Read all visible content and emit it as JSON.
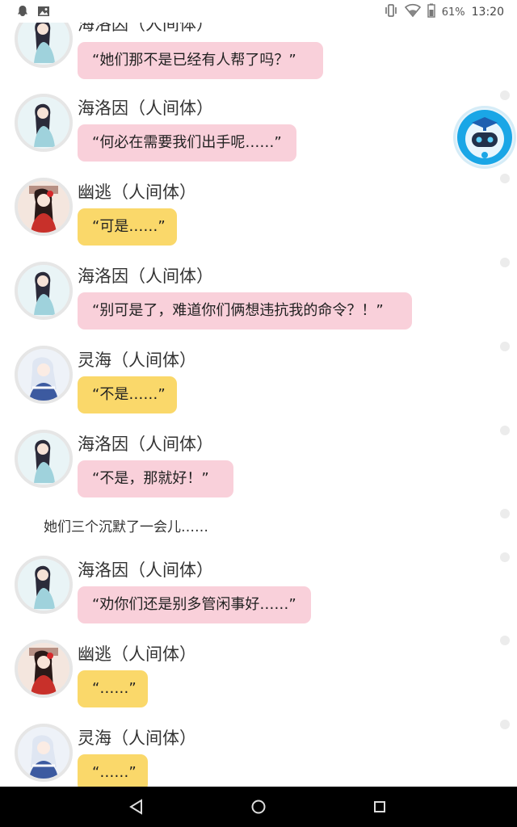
{
  "status_bar": {
    "battery": "61%",
    "time": "13:20"
  },
  "messages": [
    {
      "name": "海洛因（人间体）",
      "text": "“她们那不是已经有人帮了吗？”",
      "color": "pink",
      "avatar": "haeluoyin-avatar"
    },
    {
      "name": "海洛因（人间体）",
      "text": "“何必在需要我们出手呢……”",
      "color": "pink",
      "avatar": "haeluoyin-avatar"
    },
    {
      "name": "幽逃（人间体）",
      "text": "“可是……”",
      "color": "yellow",
      "avatar": "youtao-avatar"
    },
    {
      "name": "海洛因（人间体）",
      "text": "“别可是了，难道你们俩想违抗我的命令？！”",
      "color": "pink",
      "avatar": "haeluoyin-avatar"
    },
    {
      "name": "灵海（人间体）",
      "text": "“不是……”",
      "color": "yellow",
      "avatar": "linghai-avatar"
    },
    {
      "name": "海洛因（人间体）",
      "text": "“不是，那就好！”",
      "color": "pink",
      "avatar": "haeluoyin-avatar"
    },
    {
      "name": "海洛因（人间体）",
      "text": "“劝你们还是别多管闲事好……”",
      "color": "pink",
      "avatar": "haeluoyin-avatar"
    },
    {
      "name": "幽逃（人间体）",
      "text": "“……”",
      "color": "yellow",
      "avatar": "youtao-avatar"
    },
    {
      "name": "灵海（人间体）",
      "text": "“……”",
      "color": "yellow",
      "avatar": "linghai-avatar"
    }
  ],
  "narration": "她们三个沉默了一会儿……",
  "colors": {
    "pink_bubble": "#f9d0da",
    "yellow_bubble": "#fad86a",
    "nav_bar": "#000000"
  },
  "nav": {
    "back_icon": "triangle-back-icon",
    "home_icon": "circle-home-icon",
    "recents_icon": "square-recents-icon"
  }
}
